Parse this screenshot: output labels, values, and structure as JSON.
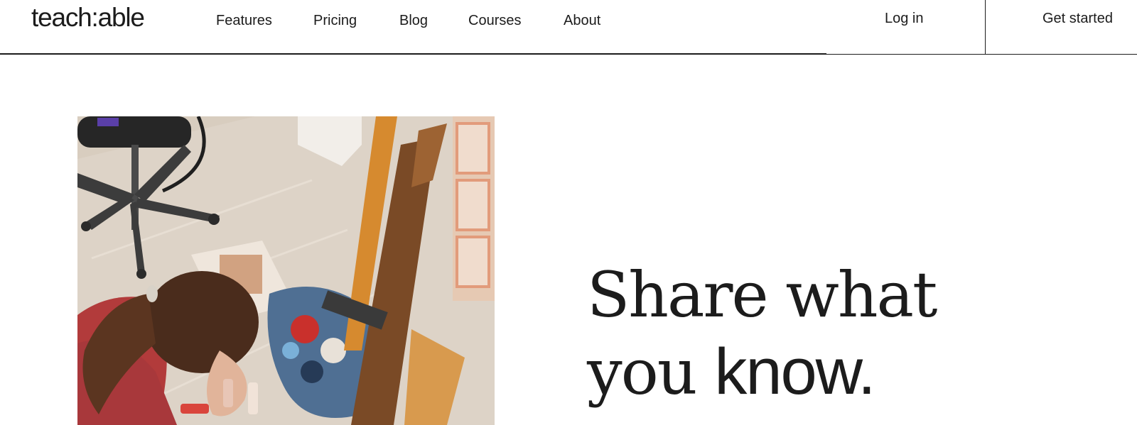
{
  "header": {
    "logo": "teach:able",
    "nav": [
      {
        "label": "Features"
      },
      {
        "label": "Pricing"
      },
      {
        "label": "Blog"
      },
      {
        "label": "Courses"
      },
      {
        "label": "About"
      }
    ],
    "login_label": "Log in",
    "cta_label": "Get started"
  },
  "hero": {
    "headline_line1": "Share what",
    "headline_line2_prefix": "you ",
    "headline_line2_emphasis": "know.",
    "image_subject": "artist-painting-photo"
  },
  "colors": {
    "text": "#1c1c1c",
    "background": "#ffffff"
  }
}
